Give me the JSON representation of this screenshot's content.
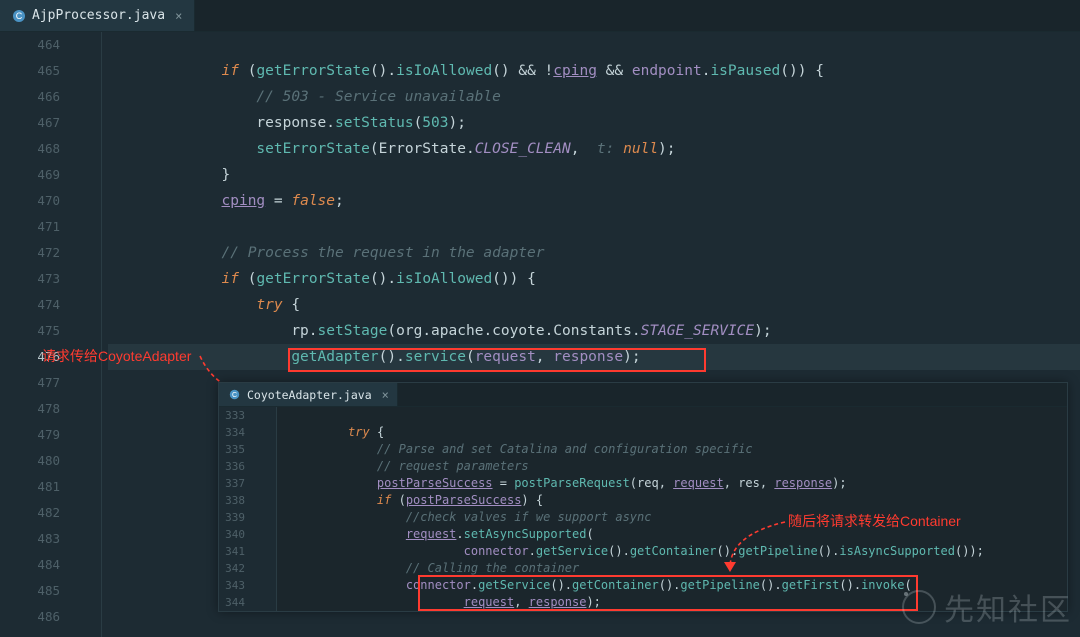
{
  "tab": {
    "filename": "AjpProcessor.java"
  },
  "lines": {
    "start": 464,
    "end": 486
  },
  "code": {
    "l464": "",
    "l465_pre": "        if (",
    "l465_cond": "getErrorState().isIoAllowed() && !cping && endpoint.isPaused()) {",
    "l466_cmt": "            // 503 - Service unavailable",
    "l467": "            response.setStatus(503);",
    "l468": "            setErrorState(ErrorState.CLOSE_CLEAN,  t: null);",
    "l469": "        }",
    "l470": "        cping = false;",
    "l471": "",
    "l472_cmt": "        // Process the request in the adapter",
    "l473": "        if (getErrorState().isIoAllowed()) {",
    "l474": "            try {",
    "l475": "                rp.setStage(org.apache.coyote.Constants.STAGE_SERVICE);",
    "l476": "                getAdapter().service(request, response);",
    "l477": ""
  },
  "annotations": {
    "left_label": "请求传给CoyoteAdapter",
    "right_label": "随后将请求转发给Container"
  },
  "inner": {
    "tab_filename": "CoyoteAdapter.java",
    "start": 333,
    "lines": {
      "l333": "",
      "l334": "        try {",
      "l335": "            // Parse and set Catalina and configuration specific",
      "l336": "            // request parameters",
      "l337": "            postParseSuccess = postParseRequest(req, request, res, response);",
      "l338": "            if (postParseSuccess) {",
      "l339": "                //check valves if we support async",
      "l340": "                request.setAsyncSupported(",
      "l341": "                        connector.getService().getContainer().getPipeline().isAsyncSupported());",
      "l342": "                // Calling the container",
      "l343": "                connector.getService().getContainer().getPipeline().getFirst().invoke(",
      "l344": "                        request, response);"
    }
  },
  "watermark": "先知社区"
}
